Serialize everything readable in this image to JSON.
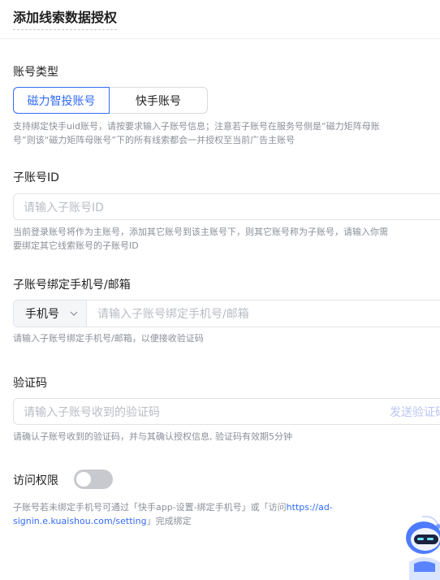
{
  "header": {
    "title": "添加线索数据授权"
  },
  "account_type": {
    "label": "账号类型",
    "options": [
      "磁力智投账号",
      "快手账号"
    ],
    "selected": "磁力智投账号",
    "hint_line1": "支持绑定快手uid账号，请按要求输入子账号信息；注意若子账号在服务号侧是“磁力矩阵母账",
    "hint_line2": "号”则该“磁力矩阵母账号”下的所有线索都会一并授权至当前广告主账号"
  },
  "sub_account": {
    "label": "子账号ID",
    "placeholder": "请输入子账号ID",
    "hint_line1": "当前登录账号将作为主账号，添加其它账号到该主账号下，则其它账号称为子账号，请输入你需",
    "hint_line2": "要绑定其它线索账号的子账号ID"
  },
  "contact": {
    "label": "子账号绑定手机号/邮箱",
    "type_value": "手机号",
    "placeholder": "请输入子账号绑定手机号/邮箱",
    "hint": "请输入子账号绑定手机号/邮箱，以便接收验证码"
  },
  "verify": {
    "label": "验证码",
    "placeholder": "请输入子账号收到的验证码",
    "send_label": "发送验证码",
    "hint": "请确认子账号收到的验证码，并与其确认授权信息, 验证码有效期5分钟"
  },
  "access": {
    "label": "访问权限",
    "enabled": false,
    "note_prefix": "子账号若未绑定手机号可通过「快手app-设置-绑定手机号」或「访问",
    "note_link_part1": "https://ad-",
    "note_link_part2": "signin.e.kuaishou.com/setting",
    "note_suffix": "」完成绑定"
  },
  "colors": {
    "accent": "#326bfb",
    "muted": "#8a8f99",
    "toggle_off": "#c7c9ce"
  },
  "icons": {
    "chevron": "chevron-down-icon",
    "assistant": "robot-assistant-icon"
  }
}
